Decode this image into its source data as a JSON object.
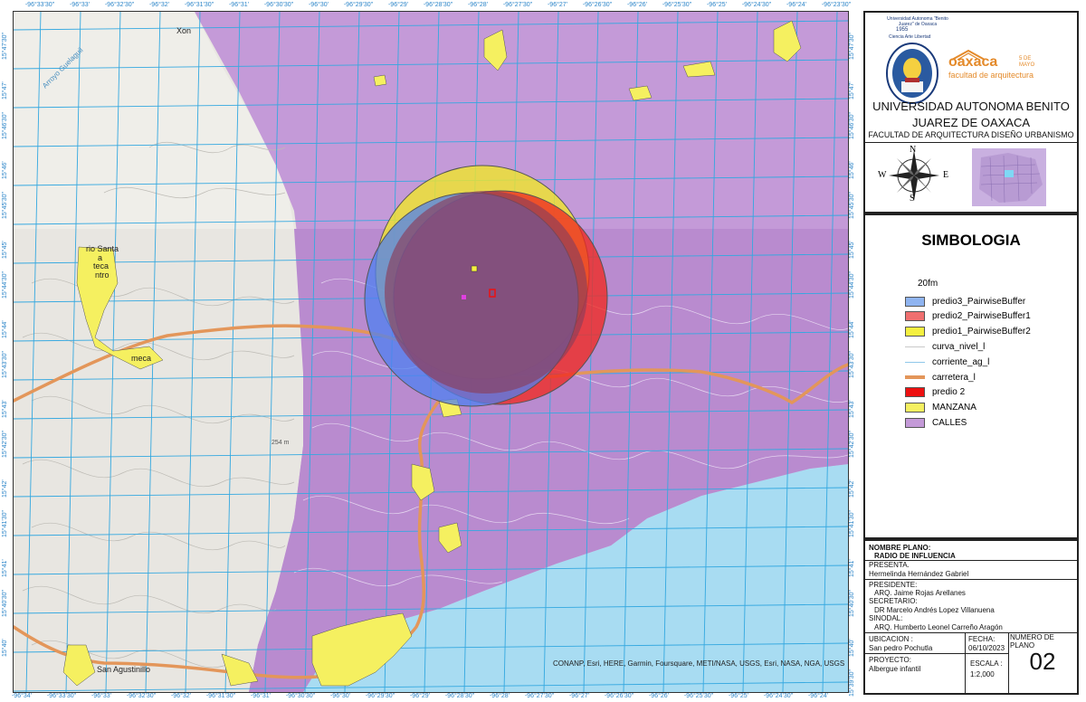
{
  "coords": {
    "top": [
      "-96°33'30\"",
      "-96°33'",
      "-96°32'30\"",
      "-96°32'",
      "-96°31'30\"",
      "-96°31'",
      "-96°30'30\"",
      "-96°30'",
      "-96°29'30\"",
      "-96°29'",
      "-96°28'30\"",
      "-96°28'",
      "-96°27'30\"",
      "-96°27'",
      "-96°26'30\"",
      "-96°26'",
      "-96°25'30\"",
      "-96°25'",
      "-96°24'30\"",
      "-96°24'",
      "-96°23'30\""
    ],
    "bottom": [
      "-96°34'",
      "-96°33'30\"",
      "-96°33'",
      "-96°32'30\"",
      "-96°32'",
      "-96°31'30\"",
      "-96°31'",
      "-96°30'30\"",
      "-96°30'",
      "-96°29'30\"",
      "-96°29'",
      "-96°28'30\"",
      "-96°28'",
      "-96°27'30\"",
      "-96°27'",
      "-96°26'30\"",
      "-96°26'",
      "-96°25'30\"",
      "-96°25'",
      "-96°24'30\"",
      "-96°24'"
    ],
    "left": [
      "15°47'30\"",
      "15°47'",
      "15°46'30\"",
      "15°46'",
      "15°45'30\"",
      "15°45'",
      "15°44'30\"",
      "15°44'",
      "15°43'30\"",
      "15°43'",
      "15°42'30\"",
      "15°42'",
      "15°41'30\"",
      "15°41'",
      "15°40'30\"",
      "15°40'"
    ],
    "right": [
      "15°47'30\"",
      "15°47'",
      "15°46'30\"",
      "15°46'",
      "15°45'30\"",
      "15°45'",
      "15°44'30\"",
      "15°44'",
      "15°43'30\"",
      "15°43'",
      "15°42'30\"",
      "15°42'",
      "15°41'30\"",
      "15°41'",
      "15°40'30\"",
      "15°40'",
      "15°39'30\""
    ]
  },
  "map": {
    "attribution": "CONANP, Esri, HERE, Garmin, Foursquare, METI/NASA, USGS, Esri, NASA, NGA, USGS",
    "labels": {
      "xon": "Xon",
      "arroyo": "Arroyo Guelaguil",
      "santa": "rio Santa",
      "a": "a",
      "teca": "teca",
      "ntro": "ntro",
      "meca": "meca",
      "san_agustinillo": "San Agustinillo",
      "elev": "254 m"
    },
    "colors": {
      "calles": "#c49ad8",
      "manzana": "#f5f060",
      "buffer1": "#f0e62a",
      "buffer2": "#f02a20",
      "buffer3": "#4f80f0",
      "ocean": "#a8dcf2",
      "grid": "#34a8e0",
      "carretera": "#e3965a",
      "predio2": "#ee1111"
    }
  },
  "header": {
    "university": "UNIVERSIDAD AUTONOMA BENITO",
    "university2": "JUAREZ  DE OAXACA",
    "faculty": "FACULTAD DE ARQUITECTURA  DISEÑO URBANISMO",
    "logo_brand": "oaxaca",
    "logo_sub": "facultad de arquitectura",
    "logo_tag": "5 DE MAYO",
    "seal_year": "1955",
    "seal_motto": "Ciencia Arte Libertad",
    "seal_ring": "Universidad Autonoma \"Benito Juarez\" de Oaxaca"
  },
  "compass": {
    "n": "N",
    "s": "S",
    "e": "E",
    "w": "W"
  },
  "legend": {
    "title": "SIMBOLOGIA",
    "heading": "20fm",
    "items": [
      {
        "label": "predio3_PairwiseBuffer",
        "kind": "box",
        "color": "#8fb4f0"
      },
      {
        "label": "predio2_PairwiseBuffer1",
        "kind": "box",
        "color": "#f07070"
      },
      {
        "label": "predio1_PairwiseBuffer2",
        "kind": "box",
        "color": "#f5f040"
      },
      {
        "label": "curva_nivel_l",
        "kind": "line",
        "color": "#c9c9c9"
      },
      {
        "label": "corriente_ag_l",
        "kind": "line",
        "color": "#8fc8ea"
      },
      {
        "label": "carretera_l",
        "kind": "thick",
        "color": "#e3965a"
      },
      {
        "label": "predio 2",
        "kind": "box",
        "color": "#ee1111"
      },
      {
        "label": "MANZANA",
        "kind": "box",
        "color": "#f5f060"
      },
      {
        "label": "CALLES",
        "kind": "box",
        "color": "#c49ad8"
      }
    ]
  },
  "info": {
    "nombre_label": "NOMBRE PLANO:",
    "nombre_value": "RADIO DE INFLUENCIA",
    "presenta_label": "PRESENTA.",
    "presenta_value": "Hermelinda Hernández Gabriel",
    "presidente_label": "PRESIDENTE:",
    "presidente_value": "ARQ. Jaime Rojas Arellanes",
    "secretario_label": "SECRETARIO:",
    "secretario_value": "DR Marcelo Andrés Lopez Villanuena",
    "sinodal_label": "SINODAL:",
    "sinodal_value": "ARQ. Humberto Leonel Carreño Aragón",
    "ubicacion_label": "UBICACION :",
    "ubicacion_value": "San pedro Pochutla",
    "fecha_label": "FECHA:",
    "fecha_value": "06/10/2023",
    "numero_label": "NUMERO DE PLANO",
    "numero_value": "02",
    "proyecto_label": "PROYECTO:",
    "proyecto_value": "Albergue infantil",
    "escala_label": "ESCALA :",
    "escala_value": "1:2,000"
  }
}
